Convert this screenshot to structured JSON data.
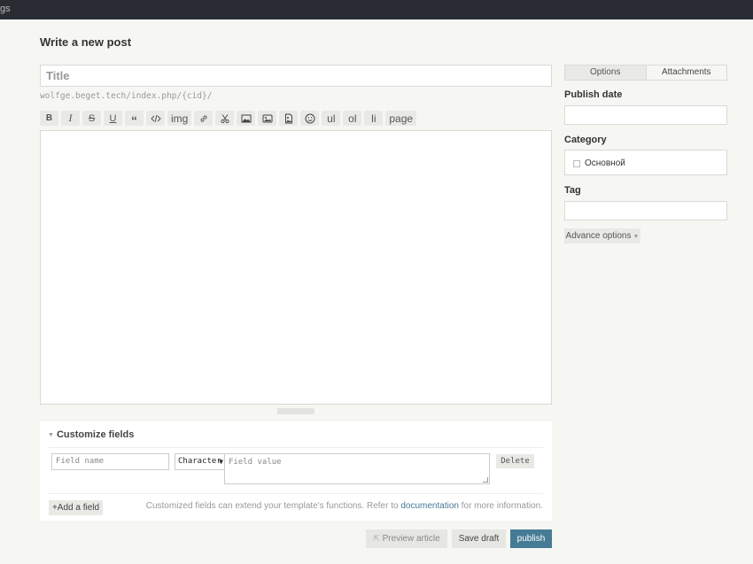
{
  "topbar": {
    "partial_label": "gs"
  },
  "page": {
    "title": "Write a new post"
  },
  "editor": {
    "title_placeholder": "Title",
    "url_hint": "wolfge.beget.tech/index.php/{cid}/",
    "toolbar": [
      {
        "name": "bold-button",
        "label": "B",
        "icon": ""
      },
      {
        "name": "italic-button",
        "label": "I",
        "icon": ""
      },
      {
        "name": "strikethrough-button",
        "label": "S",
        "icon": ""
      },
      {
        "name": "underline-button",
        "label": "U",
        "icon": ""
      },
      {
        "name": "blockquote-button",
        "label": "“",
        "icon": ""
      },
      {
        "name": "code-button",
        "label": "",
        "icon": "code-icon"
      },
      {
        "name": "insert-image-button",
        "label": "img",
        "icon": ""
      },
      {
        "name": "link-button",
        "label": "",
        "icon": "link-icon"
      },
      {
        "name": "cut-button",
        "label": "",
        "icon": "scissors-icon"
      },
      {
        "name": "image-button",
        "label": "",
        "icon": "image-icon"
      },
      {
        "name": "gallery-button",
        "label": "",
        "icon": "gallery-icon"
      },
      {
        "name": "attachment-button",
        "label": "",
        "icon": "file-image-icon"
      },
      {
        "name": "emoji-button",
        "label": "",
        "icon": "smiley-icon"
      },
      {
        "name": "unordered-list-button",
        "label": "ul",
        "icon": ""
      },
      {
        "name": "ordered-list-button",
        "label": "ol",
        "icon": ""
      },
      {
        "name": "list-item-button",
        "label": "li",
        "icon": ""
      },
      {
        "name": "page-break-button",
        "label": "page",
        "icon": ""
      }
    ]
  },
  "custom_fields": {
    "heading": "Customize fields",
    "field_name_placeholder": "Field name",
    "field_type_value": "Character",
    "field_value_placeholder": "Field value",
    "delete_label": "Delete",
    "add_label": "+Add a field",
    "note_before": "Customized fields can extend your template's functions. Refer to ",
    "note_link": "documentation",
    "note_after": " for more information."
  },
  "actions": {
    "preview_label": "Preview article",
    "draft_label": "Save draft",
    "publish_label": "publish"
  },
  "sidebar": {
    "tabs": [
      "Options",
      "Attachments"
    ],
    "publish_date_label": "Publish date",
    "category_label": "Category",
    "category_option": "Основной",
    "tag_label": "Tag",
    "advance_label": "Advance options"
  },
  "colors": {
    "accent": "#467b96",
    "topbar": "#292d33",
    "background": "#f6f6f3"
  }
}
